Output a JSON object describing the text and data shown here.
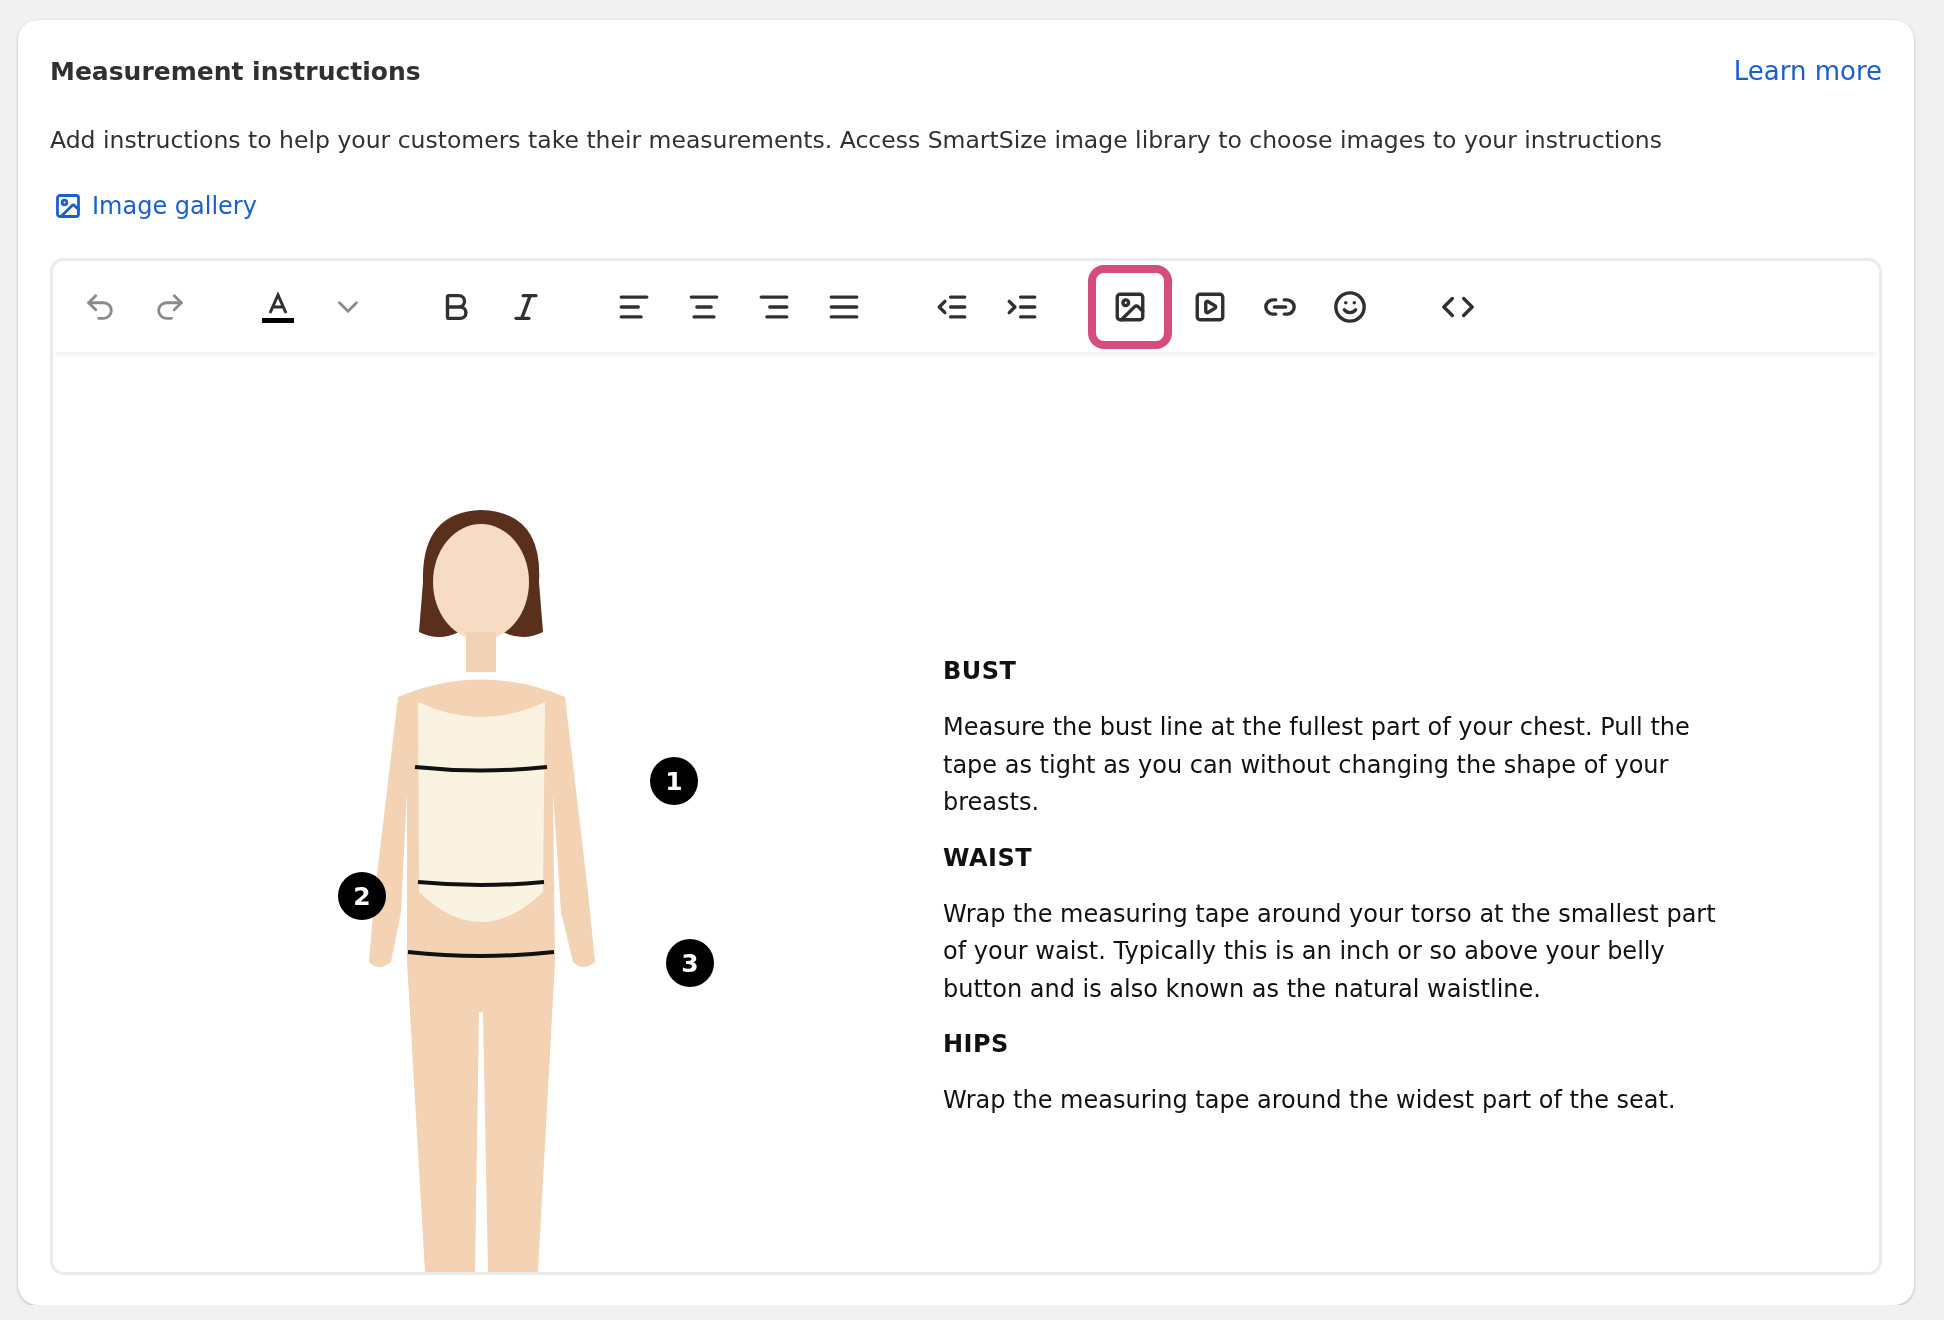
{
  "header": {
    "title": "Measurement instructions",
    "link": "Learn more"
  },
  "description": "Add instructions to help your customers take their measurements. Access SmartSize image library to choose images to your instructions",
  "gallery_link": "Image gallery",
  "toolbar": {
    "groups": [
      [
        {
          "kind": "undo",
          "highlighted": false
        },
        {
          "kind": "redo",
          "highlighted": false
        }
      ],
      [
        {
          "kind": "text-color",
          "highlighted": false,
          "color": "#000000"
        },
        {
          "kind": "dropdown",
          "highlighted": false
        }
      ],
      [
        {
          "kind": "bold",
          "highlighted": false
        },
        {
          "kind": "italic",
          "highlighted": false
        }
      ],
      [
        {
          "kind": "align-left",
          "highlighted": false
        },
        {
          "kind": "align-center",
          "highlighted": false
        },
        {
          "kind": "align-right",
          "highlighted": false
        },
        {
          "kind": "justify",
          "highlighted": false
        }
      ],
      [
        {
          "kind": "outdent",
          "highlighted": false
        },
        {
          "kind": "indent",
          "highlighted": false
        }
      ],
      [
        {
          "kind": "image",
          "highlighted": true
        },
        {
          "kind": "video",
          "highlighted": false
        },
        {
          "kind": "link",
          "highlighted": false
        },
        {
          "kind": "emoji",
          "highlighted": false
        }
      ],
      [
        {
          "kind": "code",
          "highlighted": false
        }
      ]
    ]
  },
  "figure": {
    "markers": [
      "1",
      "2",
      "3"
    ]
  },
  "sections": [
    {
      "heading": "BUST",
      "text": "Measure the bust line at the fullest part of your chest. Pull the tape as tight as you can without changing the shape of your breasts."
    },
    {
      "heading": "WAIST",
      "text": "Wrap the measuring tape around your torso at the smallest part of your waist. Typically this is an inch or so above your belly button and is also known as the natural waistline."
    },
    {
      "heading": "HIPS",
      "text": "Wrap the measuring tape around the widest part of the seat."
    }
  ]
}
